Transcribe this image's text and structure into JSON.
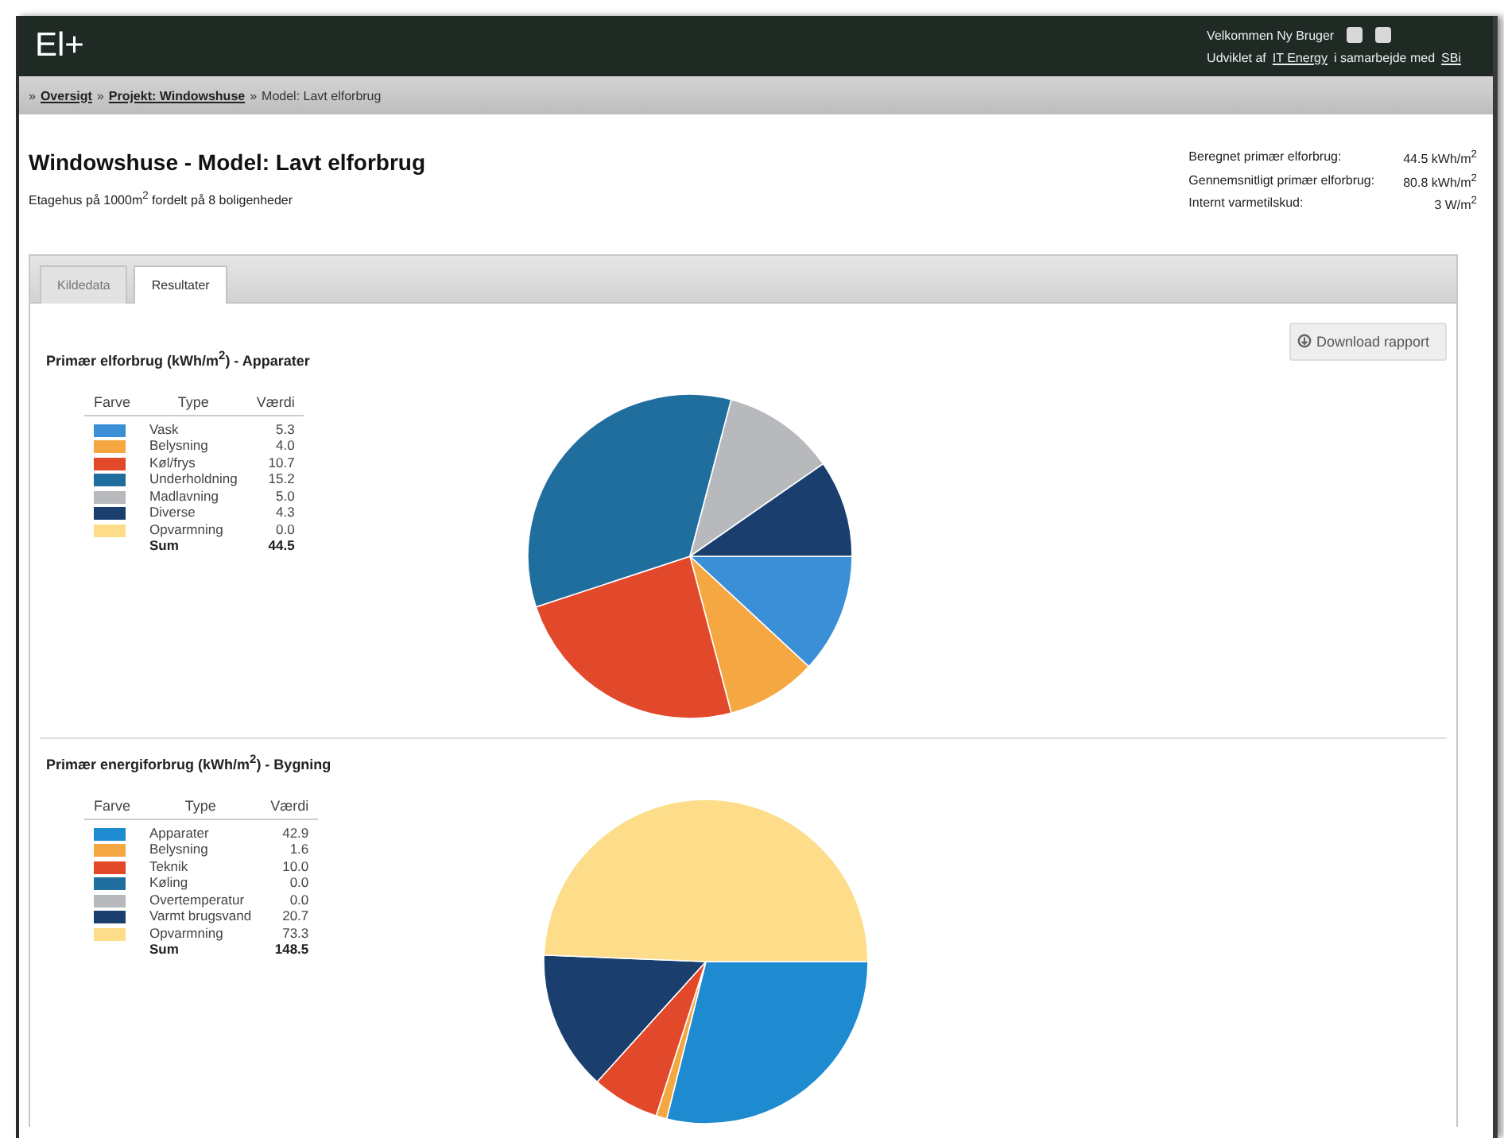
{
  "header": {
    "logo": "El+",
    "welcome": "Velkommen Ny Bruger",
    "credit_prefix": "Udviklet af",
    "credit_link": "IT Energy",
    "credit_middle": "i samarbejde med",
    "credit_partner": "SBi"
  },
  "breadcrumb": [
    {
      "separator": "»",
      "label": "Oversigt",
      "link": true
    },
    {
      "separator": "»",
      "label": "Projekt: Windowshuse",
      "link": true
    },
    {
      "separator": "»",
      "label": "Model: Lavt elforbrug",
      "link": false
    }
  ],
  "page": {
    "title": "Windowshuse - Model: Lavt elforbrug",
    "subtitle": "Etagehus på 1000m$^{2}$ fordelt på 8 boligenheder"
  },
  "stats": [
    {
      "label": "Beregnet primær elforbrug:",
      "value": "44.5 kWh/m$^{2}$"
    },
    {
      "label": "Gennemsnitligt primær elforbrug:",
      "value": "80.8 kWh/m$^{2}$"
    },
    {
      "label": "Internt varmetilskud:",
      "value": "3 W/m$^{2}$"
    }
  ],
  "tabs": [
    {
      "label": "Kildedata",
      "selected": false
    },
    {
      "label": "Resultater",
      "selected": true
    }
  ],
  "download_button": "Download rapport",
  "sections": [
    {
      "title": "Primær elforbrug (kWh/m$^{2}$) - Apparater",
      "columns": [
        "Farve",
        "Type",
        "Værdi"
      ],
      "rows": [
        {
          "value": "5.3",
          "color": "#3b8fd6"
        },
        {
          "value": "4.0",
          "color": "#f5a742"
        },
        {
          "value": "10.7",
          "color": "#e2492a"
        },
        {
          "value": "15.2",
          "color": "#1f6e9e"
        },
        {
          "value": "5.0",
          "color": "#b7b9bc"
        },
        {
          "value": "4.3",
          "color": "#1a3f6e"
        },
        {
          "value": "0.0",
          "color": "#fddc8a"
        }
      ],
      "sum": {
        "label": "Sum",
        "value": "44.5"
      },
      "chart_data": {
        "type": "pie",
        "categories": [
          "Vask",
          "Belysning",
          "Køl/frys",
          "Underholdning",
          "Madlavning",
          "Diverse",
          "Opvarmning"
        ],
        "values": [
          11.91,
          8.99,
          24.04,
          34.16,
          11.24,
          9.66,
          0
        ],
        "legend": "left"
      }
    },
    {
      "title": "Primær energiforbrug (kWh/m$^{2}$) - Bygning",
      "columns": [
        "Farve",
        "Type",
        "Værdi"
      ],
      "rows": [
        {
          "value": "42.9",
          "color": "#1e8ad0"
        },
        {
          "value": "1.6",
          "color": "#f5a742"
        },
        {
          "value": "10.0",
          "color": "#e2492a"
        },
        {
          "value": "0.0",
          "color": "#1f6e9e"
        },
        {
          "value": "0.0",
          "color": "#b7b9bc"
        },
        {
          "value": "20.7",
          "color": "#1a3f6e"
        },
        {
          "value": "73.3",
          "color": "#fddc8a"
        }
      ],
      "sum": {
        "label": "Sum",
        "value": "148.5"
      },
      "chart_data": {
        "type": "pie",
        "categories": [
          "Apparater",
          "Belysning",
          "Teknik",
          "Køling",
          "Overtemperatur",
          "Varmt brugsvand",
          "Opvarmning"
        ],
        "values": [
          28.89,
          1.08,
          6.73,
          0,
          0,
          13.94,
          49.36
        ],
        "legend": "left"
      }
    }
  ]
}
